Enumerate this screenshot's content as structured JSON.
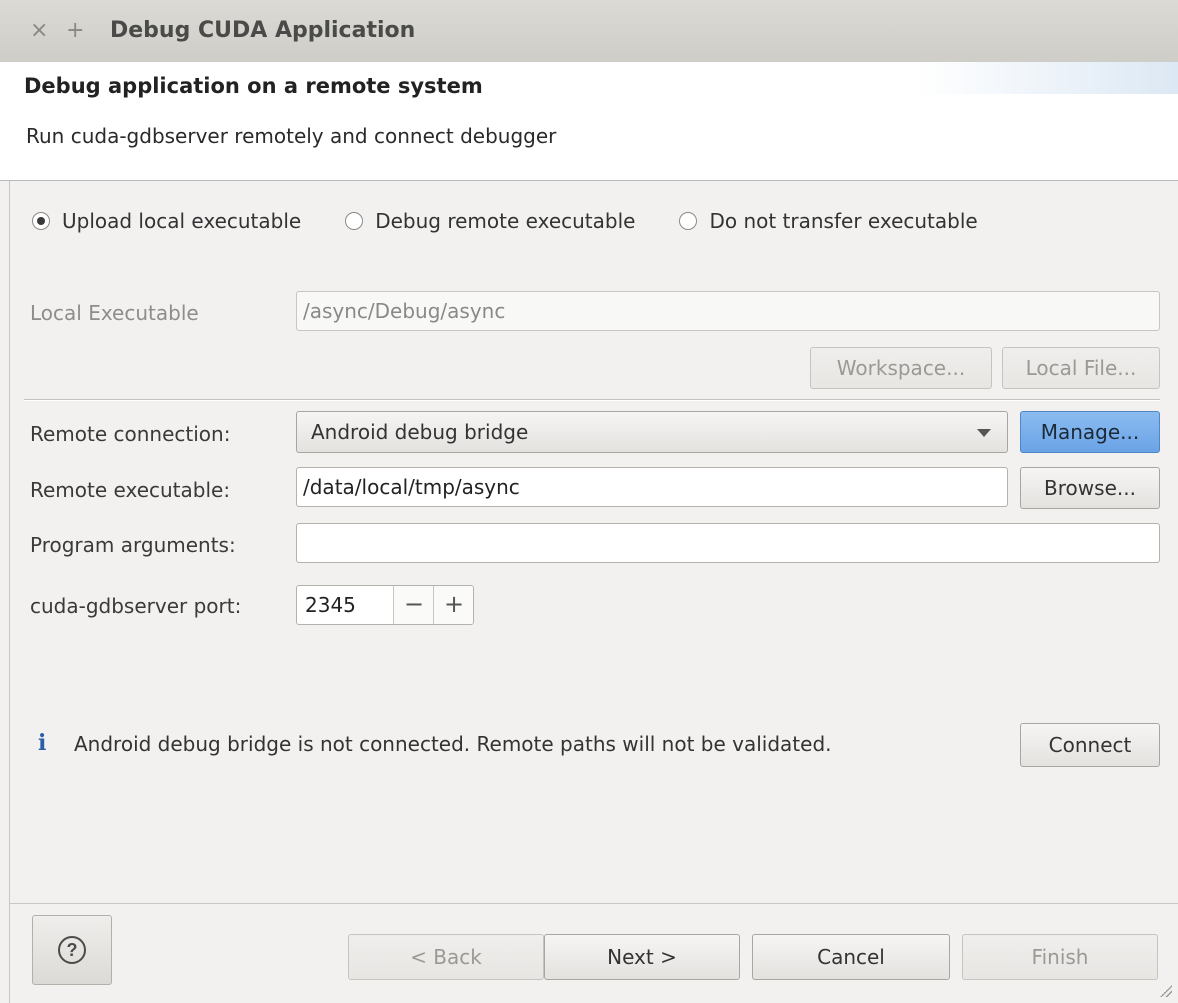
{
  "window": {
    "title": "Debug CUDA Application",
    "close_glyph": "×",
    "add_glyph": "+"
  },
  "header": {
    "title": "Debug application on a remote system",
    "subtitle": "Run cuda-gdbserver remotely and connect debugger"
  },
  "transfer_mode": {
    "options": [
      "Upload local executable",
      "Debug remote executable",
      "Do not transfer executable"
    ],
    "selected": "Upload local executable"
  },
  "local": {
    "label": "Local Executable",
    "value": "/async/Debug/async",
    "workspace_button": "Workspace...",
    "local_file_button": "Local File..."
  },
  "remote": {
    "connection_label": "Remote connection:",
    "connection_value": "Android debug bridge",
    "manage_button": "Manage...",
    "executable_label": "Remote executable:",
    "executable_value": "/data/local/tmp/async",
    "browse_button": "Browse...",
    "args_label": "Program arguments:",
    "args_value": "",
    "port_label": "cuda-gdbserver port:",
    "port_value": "2345",
    "minus_glyph": "−",
    "plus_glyph": "+"
  },
  "status": {
    "icon": "info-icon",
    "icon_glyph": "i",
    "message": "Android debug bridge is not connected. Remote paths will not be validated.",
    "connect_button": "Connect"
  },
  "footer": {
    "help_glyph": "?",
    "back_button": "< Back",
    "next_button": "Next >",
    "cancel_button": "Cancel",
    "finish_button": "Finish"
  },
  "colors": {
    "accent": "#6aa3e6",
    "info_icon": "#2a5ea8"
  }
}
